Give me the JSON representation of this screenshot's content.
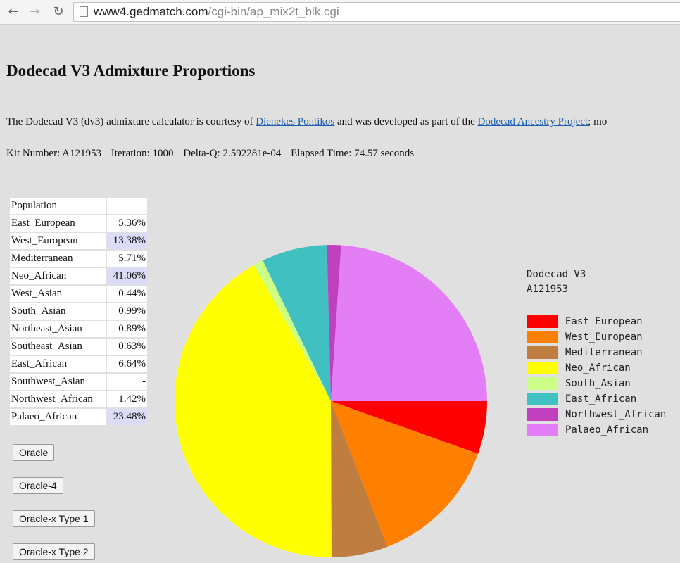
{
  "browser": {
    "url_host": "www4.gedmatch.com",
    "url_path": "/cgi-bin/ap_mix2t_blk.cgi"
  },
  "page": {
    "title": "Dodecad V3 Admixture Proportions",
    "intro": {
      "before": "The Dodecad V3 (dv3) admixture calculator is courtesy of ",
      "link1": "Dienekes Pontikos",
      "middle": " and was developed as part of the ",
      "link2": "Dodecad Ancestry Project",
      "after": "; mo"
    },
    "kit": {
      "kit_number": "Kit Number: A121953",
      "iteration": "Iteration: 1000",
      "delta_q": "Delta-Q: 2.592281e-04",
      "elapsed": "Elapsed Time: 74.57 seconds"
    }
  },
  "table": {
    "header": "Population",
    "rows": [
      {
        "name": "East_European",
        "value": "5.36%"
      },
      {
        "name": "West_European",
        "value": "13.38%"
      },
      {
        "name": "Mediterranean",
        "value": "5.71%"
      },
      {
        "name": "Neo_African",
        "value": "41.06%"
      },
      {
        "name": "West_Asian",
        "value": "0.44%"
      },
      {
        "name": "South_Asian",
        "value": "0.99%"
      },
      {
        "name": "Northeast_Asian",
        "value": "0.89%"
      },
      {
        "name": "Southeast_Asian",
        "value": "0.63%"
      },
      {
        "name": "East_African",
        "value": "6.64%"
      },
      {
        "name": "Southwest_Asian",
        "value": "-"
      },
      {
        "name": "Northwest_African",
        "value": "1.42%"
      },
      {
        "name": "Palaeo_African",
        "value": "23.48%"
      }
    ]
  },
  "buttons": {
    "oracle": "Oracle",
    "oracle4": "Oracle-4",
    "oraclex1": "Oracle-x Type 1",
    "oraclex2": "Oracle-x Type 2"
  },
  "legend": {
    "title": "Dodecad V3",
    "kit": "A121953",
    "items": [
      {
        "label": "East_European",
        "color": "#ff0000"
      },
      {
        "label": "West_European",
        "color": "#ff8000"
      },
      {
        "label": "Mediterranean",
        "color": "#bf7d40"
      },
      {
        "label": "Neo_African",
        "color": "#ffff00"
      },
      {
        "label": "South_Asian",
        "color": "#ccff88"
      },
      {
        "label": "East_African",
        "color": "#40c0c0"
      },
      {
        "label": "Northwest_African",
        "color": "#c040c0"
      },
      {
        "label": "Palaeo_African",
        "color": "#e47ef6"
      }
    ]
  },
  "chart_data": {
    "type": "pie",
    "slices": [
      {
        "label": "East_European",
        "value": 5.36,
        "color": "#ff0000"
      },
      {
        "label": "West_European",
        "value": 13.38,
        "color": "#ff8000"
      },
      {
        "label": "Mediterranean",
        "value": 5.71,
        "color": "#bf7d40"
      },
      {
        "label": "Neo_African",
        "value": 41.06,
        "color": "#ffff00"
      },
      {
        "label": "South_Asian",
        "value": 0.99,
        "color": "#ccff88"
      },
      {
        "label": "East_African",
        "value": 6.64,
        "color": "#40c0c0"
      },
      {
        "label": "Northwest_African",
        "value": 1.42,
        "color": "#c040c0"
      },
      {
        "label": "Palaeo_African",
        "value": 23.48,
        "color": "#e47ef6"
      }
    ]
  }
}
